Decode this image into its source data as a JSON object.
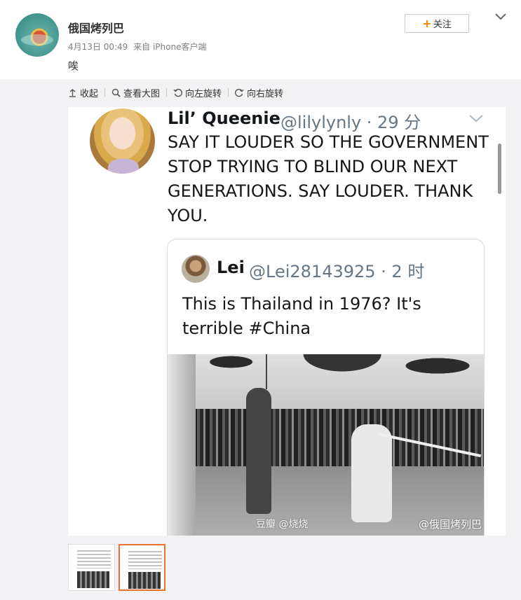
{
  "post": {
    "username": "俄国烤列巴",
    "date": "4月13日 00:49",
    "source": "来自 iPhone客户端",
    "text": "唉",
    "follow_label": "关注"
  },
  "toolbar": {
    "collapse_label": "收起",
    "view_large_label": "查看大图",
    "rotate_left_label": "向左旋转",
    "rotate_right_label": "向右旋转"
  },
  "tweet": {
    "name": "Lil’ Queenie",
    "handle": "@lilylynly · 29 分",
    "text": "SAY IT LOUDER SO THE GOVERNMENT STOP TRYING TO BLIND OUR NEXT GENERATIONS. SAY LOUDER. THANK YOU.",
    "quote": {
      "name": "Lei",
      "handle": "@Lei28143925 · 2 时",
      "text": "This is Thailand in 1976?  It's terrible #China"
    }
  },
  "watermarks": {
    "douban": "豆瓣 @烧烧",
    "weibo": "@俄国烤列巴"
  },
  "colors": {
    "accent_orange": "#ff8200",
    "active_thumb_border": "#e8742b",
    "media_bg": "#f2f2f5"
  }
}
